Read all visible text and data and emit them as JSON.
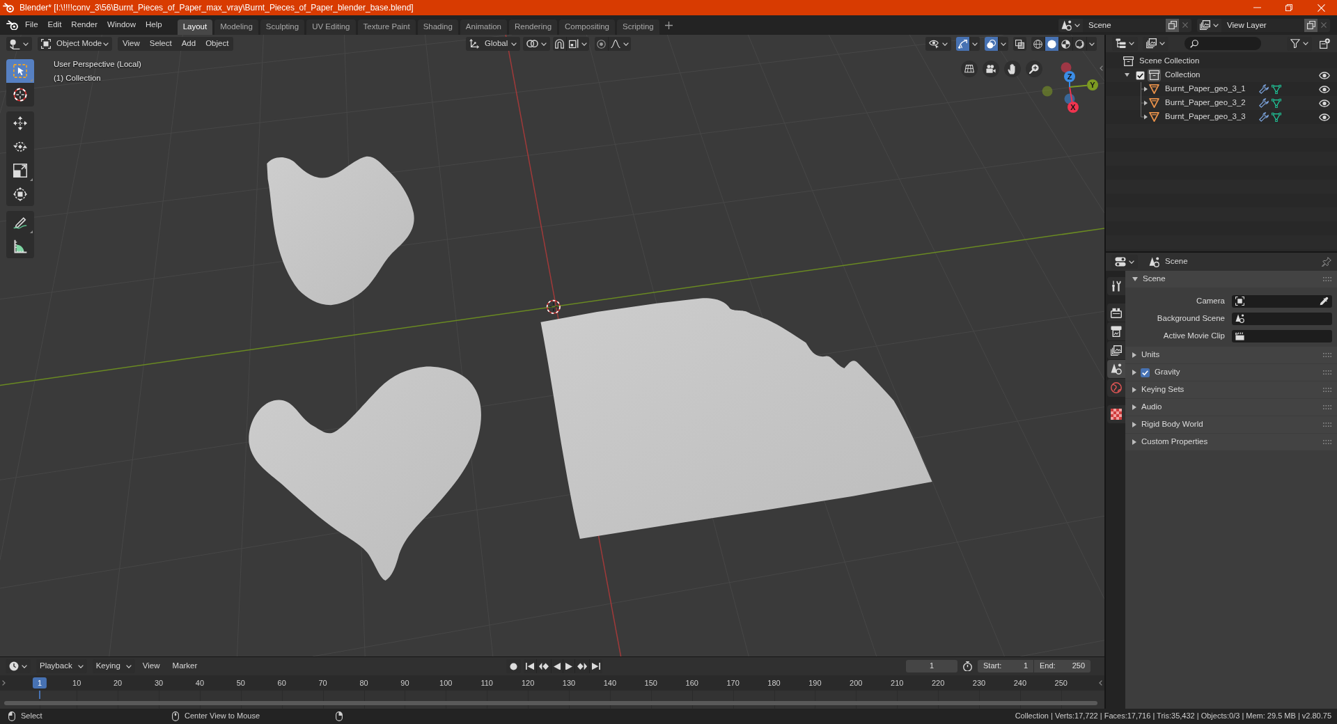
{
  "window": {
    "title": "Blender* [I:\\!!!!conv_3\\56\\Burnt_Pieces_of_Paper_max_vray\\Burnt_Pieces_of_Paper_blender_base.blend]"
  },
  "menu": [
    "File",
    "Edit",
    "Render",
    "Window",
    "Help"
  ],
  "workspaces": [
    {
      "label": "Layout",
      "selected": true
    },
    {
      "label": "Modeling",
      "selected": false
    },
    {
      "label": "Sculpting",
      "selected": false
    },
    {
      "label": "UV Editing",
      "selected": false
    },
    {
      "label": "Texture Paint",
      "selected": false
    },
    {
      "label": "Shading",
      "selected": false
    },
    {
      "label": "Animation",
      "selected": false
    },
    {
      "label": "Rendering",
      "selected": false
    },
    {
      "label": "Compositing",
      "selected": false
    },
    {
      "label": "Scripting",
      "selected": false
    }
  ],
  "scene": "Scene",
  "view_layer": "View Layer",
  "viewport": {
    "header": {
      "mode": "Object Mode",
      "menus": [
        "View",
        "Select",
        "Add",
        "Object"
      ],
      "orientation": "Global",
      "snap": {
        "on": false
      },
      "proportional": {
        "on": false
      },
      "gizmos": {
        "on": true
      },
      "overlays": {
        "on": true
      },
      "xray": {
        "on": false
      },
      "shading": [
        {
          "kind": "wireframe",
          "selected": false
        },
        {
          "kind": "solid",
          "selected": true
        },
        {
          "kind": "material",
          "selected": false
        },
        {
          "kind": "rendered",
          "selected": false
        }
      ]
    },
    "overlay_text": [
      "User Perspective (Local)",
      "(1) Collection"
    ],
    "tool_groups": [
      [
        {
          "kind": "select_box",
          "selected": true
        },
        {
          "kind": "cursor",
          "selected": false
        }
      ],
      [
        {
          "kind": "move",
          "selected": false
        },
        {
          "kind": "rotate",
          "selected": false
        },
        {
          "kind": "scale",
          "selected": false
        },
        {
          "kind": "transform",
          "selected": false
        }
      ],
      [
        {
          "kind": "annotate",
          "selected": false
        },
        {
          "kind": "measure",
          "selected": false
        }
      ]
    ],
    "axes": [
      {
        "label": "X",
        "color": "#f0344f"
      },
      {
        "label": "Y",
        "color": "#7d9b22"
      },
      {
        "label": "Z",
        "color": "#3b8de6"
      }
    ]
  },
  "outliner": {
    "items": [
      {
        "name": "Scene Collection",
        "kind": "scene_collection",
        "children": [
          {
            "name": "Collection",
            "kind": "collection",
            "expanded": true,
            "checked": true,
            "active": true,
            "visible": true,
            "children": [
              {
                "name": "Burnt_Paper_geo_3_1",
                "kind": "mesh",
                "expanded": false,
                "visible": true
              },
              {
                "name": "Burnt_Paper_geo_3_2",
                "kind": "mesh",
                "expanded": false,
                "visible": true
              },
              {
                "name": "Burnt_Paper_geo_3_3",
                "kind": "mesh",
                "expanded": false,
                "visible": true
              }
            ]
          }
        ]
      }
    ]
  },
  "properties": {
    "context": "Scene",
    "tab_groups": [
      [
        {
          "kind": "tool",
          "selected": false
        }
      ],
      [
        {
          "kind": "render",
          "selected": false
        },
        {
          "kind": "output",
          "selected": false
        },
        {
          "kind": "view_layer",
          "selected": false
        },
        {
          "kind": "scene",
          "selected": true
        },
        {
          "kind": "world",
          "selected": false
        }
      ],
      [
        {
          "kind": "texture",
          "selected": false
        }
      ]
    ],
    "panels": [
      {
        "title": "Scene",
        "expanded": true,
        "fields": [
          {
            "label": "Camera",
            "kind": "object"
          },
          {
            "label": "Background Scene",
            "kind": "scene"
          },
          {
            "label": "Active Movie Clip",
            "kind": "movieclip"
          }
        ]
      },
      {
        "title": "Units",
        "expanded": false
      },
      {
        "title": "Gravity",
        "expanded": false,
        "checked": true
      },
      {
        "title": "Keying Sets",
        "expanded": false
      },
      {
        "title": "Audio",
        "expanded": false
      },
      {
        "title": "Rigid Body World",
        "expanded": false
      },
      {
        "title": "Custom Properties",
        "expanded": false
      }
    ]
  },
  "timeline": {
    "menus": [
      {
        "label": "Playback",
        "kind": "dropdown"
      },
      {
        "label": "Keying",
        "kind": "dropdown"
      },
      {
        "label": "View",
        "kind": "menu"
      },
      {
        "label": "Marker",
        "kind": "menu"
      }
    ],
    "auto_keying": {
      "on": false
    },
    "current_frame": "1",
    "start": {
      "label": "Start:",
      "value": "1"
    },
    "end": {
      "label": "End:",
      "value": "250"
    },
    "ruler": [
      {
        "label": "1",
        "selected": true
      },
      {
        "label": "10",
        "selected": false
      },
      {
        "label": "20",
        "selected": false
      },
      {
        "label": "30",
        "selected": false
      },
      {
        "label": "40",
        "selected": false
      },
      {
        "label": "50",
        "selected": false
      },
      {
        "label": "60",
        "selected": false
      },
      {
        "label": "70",
        "selected": false
      },
      {
        "label": "80",
        "selected": false
      },
      {
        "label": "90",
        "selected": false
      },
      {
        "label": "100",
        "selected": false
      },
      {
        "label": "110",
        "selected": false
      },
      {
        "label": "120",
        "selected": false
      },
      {
        "label": "130",
        "selected": false
      },
      {
        "label": "140",
        "selected": false
      },
      {
        "label": "150",
        "selected": false
      },
      {
        "label": "160",
        "selected": false
      },
      {
        "label": "170",
        "selected": false
      },
      {
        "label": "180",
        "selected": false
      },
      {
        "label": "190",
        "selected": false
      },
      {
        "label": "200",
        "selected": false
      },
      {
        "label": "210",
        "selected": false
      },
      {
        "label": "220",
        "selected": false
      },
      {
        "label": "230",
        "selected": false
      },
      {
        "label": "240",
        "selected": false
      },
      {
        "label": "250",
        "selected": false
      }
    ]
  },
  "status_bar": {
    "hints": [
      {
        "kind": "mouse_left",
        "label": "Select"
      },
      {
        "kind": "mouse_middle",
        "label": "Center View to Mouse"
      },
      {
        "kind": "mouse_right"
      }
    ],
    "stats": "Collection | Verts:17,722 | Faces:17,716 | Tris:35,432 | Objects:0/3 | Mem: 29.5 MB | v2.80.75"
  }
}
